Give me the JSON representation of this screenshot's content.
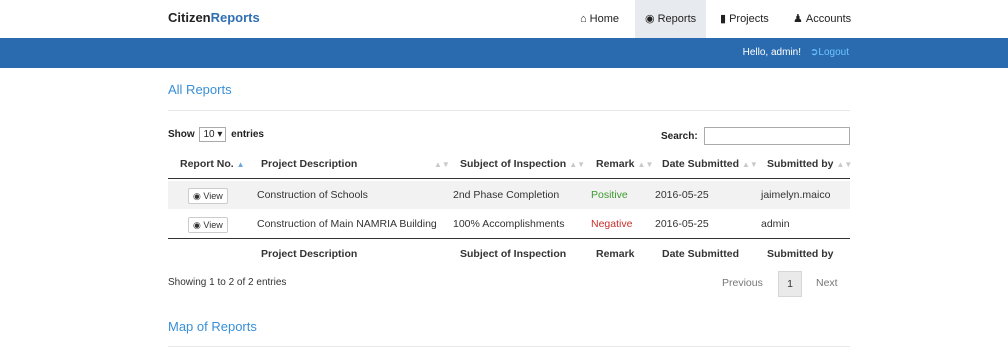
{
  "brand": {
    "part1": "Citizen",
    "part2": "Reports"
  },
  "nav": {
    "home": "Home",
    "reports": "Reports",
    "projects": "Projects",
    "accounts": "Accounts"
  },
  "userbar": {
    "hello": "Hello, admin!",
    "logout": "Logout"
  },
  "section_all": "All Reports",
  "show": {
    "prefix": "Show",
    "value": "10",
    "suffix": "entries"
  },
  "search": {
    "label": "Search:",
    "value": ""
  },
  "table": {
    "headers": [
      "Report No.",
      "Project Description",
      "Subject of Inspection",
      "Remark",
      "Date Submitted",
      "Submitted by"
    ],
    "rows": [
      {
        "action": "View",
        "description": "Construction of Schools",
        "subject": "2nd Phase Completion",
        "remark": "Positive",
        "date": "2016-05-25",
        "by": "jaimelyn.maico"
      },
      {
        "action": "View",
        "description": "Construction of Main NAMRIA Building",
        "subject": "100% Accomplishments",
        "remark": "Negative",
        "date": "2016-05-25",
        "by": "admin"
      }
    ],
    "footer": [
      "Project Description",
      "Subject of Inspection",
      "Remark",
      "Date Submitted",
      "Submitted by"
    ]
  },
  "info": "Showing 1 to 2 of 2 entries",
  "pagination": {
    "previous": "Previous",
    "current": "1",
    "next": "Next"
  },
  "section_map": "Map of Reports",
  "colors": {
    "accent": "#2a6bb0",
    "heading": "#3a8fd6",
    "positive": "#3c9a2f",
    "negative": "#c9302c"
  }
}
